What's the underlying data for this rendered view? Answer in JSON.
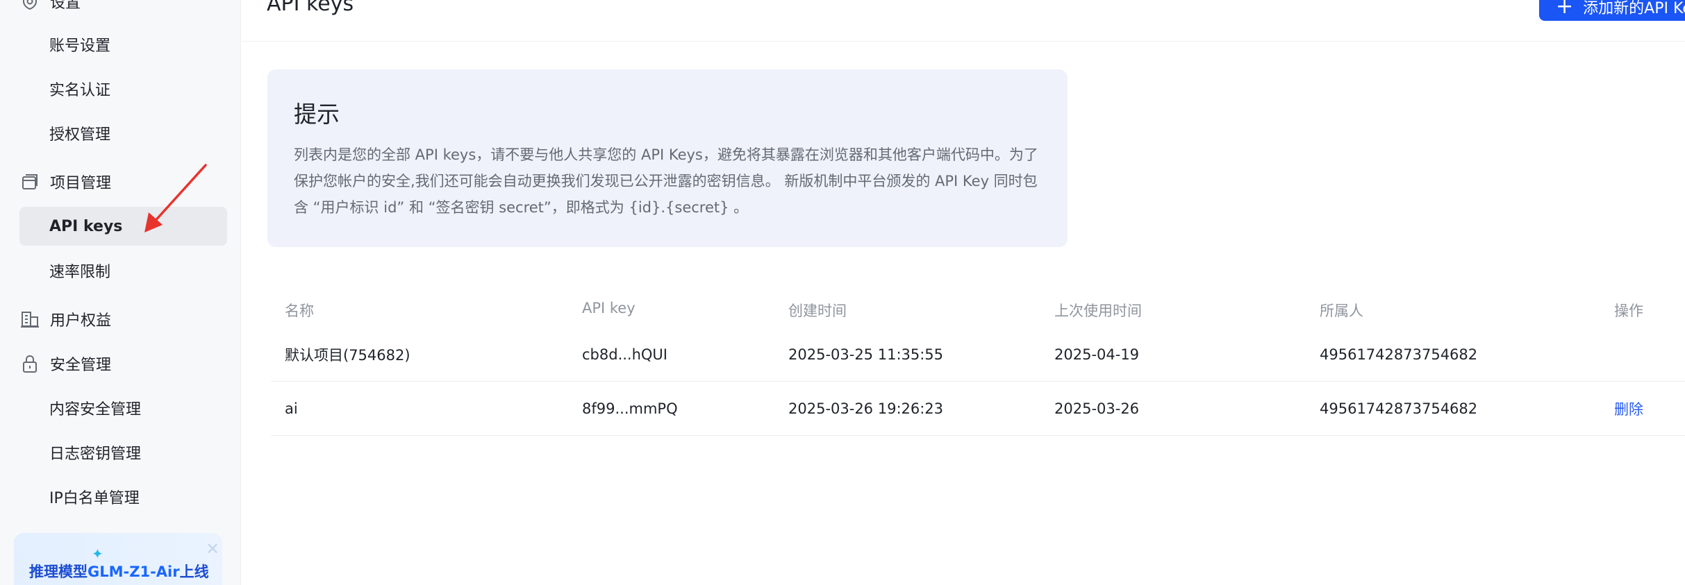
{
  "sidebar": {
    "settings_label": "设置",
    "settings_items": [
      {
        "label": "账号设置"
      },
      {
        "label": "实名认证"
      },
      {
        "label": "授权管理"
      }
    ],
    "project_label": "项目管理",
    "project_items": [
      {
        "label": "API keys",
        "active": true
      },
      {
        "label": "速率限制"
      }
    ],
    "user_rights_label": "用户权益",
    "security_label": "安全管理",
    "security_items": [
      {
        "label": "内容安全管理"
      },
      {
        "label": "日志密钥管理"
      },
      {
        "label": "IP白名单管理"
      }
    ],
    "promo": {
      "prefix": "推理模型",
      "highlight": "GLM-Z1-Air",
      "suffix": "上线"
    }
  },
  "header": {
    "title": "API keys",
    "add_button_label": "添加新的API Key"
  },
  "tip": {
    "title": "提示",
    "body": "列表内是您的全部 API keys，请不要与他人共享您的 API Keys，避免将其暴露在浏览器和其他客户端代码中。为了保护您帐户的安全,我们还可能会自动更换我们发现已公开泄露的密钥信息。 新版机制中平台颁发的 API Key 同时包含 “用户标识 id” 和 “签名密钥 secret”，即格式为 {id}.{secret} 。"
  },
  "table": {
    "columns": [
      "名称",
      "API key",
      "创建时间",
      "上次使用时间",
      "所属人",
      "操作"
    ],
    "rows": [
      {
        "name": "默认项目(754682)",
        "key": "cb8d...hQUI",
        "created": "2025-03-25 11:35:55",
        "last_used": "2025-04-19",
        "owner": "49561742873754682",
        "action": ""
      },
      {
        "name": "ai",
        "key": "8f99...mmPQ",
        "created": "2025-03-26 19:26:23",
        "last_used": "2025-03-26",
        "owner": "49561742873754682",
        "action": "删除"
      }
    ]
  },
  "colors": {
    "primary": "#1a55f5",
    "annotation_arrow": "#e8332d",
    "tip_bg": "#eff2fa"
  }
}
